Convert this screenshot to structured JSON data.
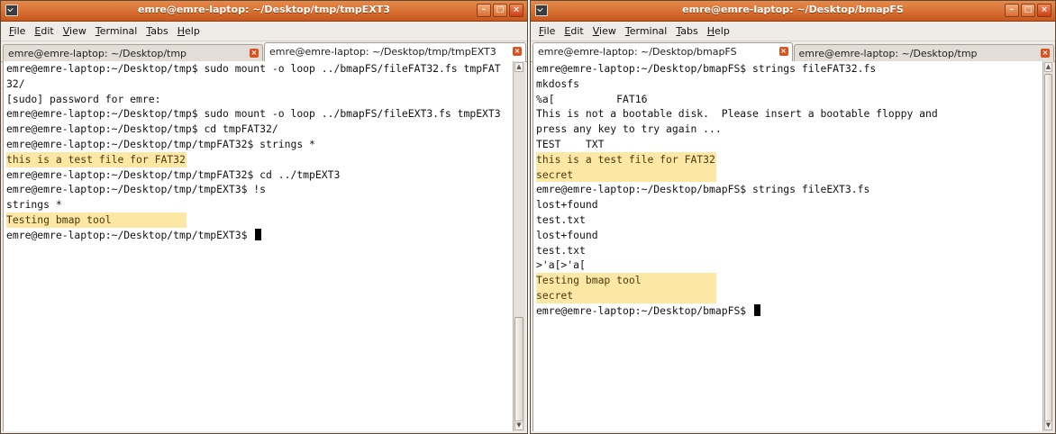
{
  "left": {
    "title": "emre@emre-laptop: ~/Desktop/tmp/tmpEXT3",
    "menus": [
      {
        "u": "F",
        "rest": "ile"
      },
      {
        "u": "E",
        "rest": "dit"
      },
      {
        "u": "V",
        "rest": "iew"
      },
      {
        "u": "T",
        "rest": "erminal"
      },
      {
        "u": "T",
        "rest": "abs"
      },
      {
        "u": "H",
        "rest": "elp"
      }
    ],
    "tabs": [
      {
        "label": "emre@emre-laptop: ~/Desktop/tmp"
      },
      {
        "label": "emre@emre-laptop: ~/Desktop/tmp/tmpEXT3"
      }
    ],
    "lines": [
      {
        "text": "emre@emre-laptop:~/Desktop/tmp$ sudo mount -o loop ../bmapFS/fileFAT32.fs tmpFAT",
        "hl": false
      },
      {
        "text": "32/",
        "hl": false
      },
      {
        "text": "[sudo] password for emre:",
        "hl": false
      },
      {
        "text": "emre@emre-laptop:~/Desktop/tmp$ sudo mount -o loop ../bmapFS/fileEXT3.fs tmpEXT3",
        "hl": false
      },
      {
        "text": "emre@emre-laptop:~/Desktop/tmp$ cd tmpFAT32/",
        "hl": false
      },
      {
        "text": "emre@emre-laptop:~/Desktop/tmp/tmpFAT32$ strings *",
        "hl": false
      },
      {
        "text": "this is a test file for FAT32",
        "hl": true
      },
      {
        "text": "emre@emre-laptop:~/Desktop/tmp/tmpFAT32$ cd ../tmpEXT3",
        "hl": false
      },
      {
        "text": "emre@emre-laptop:~/Desktop/tmp/tmpEXT3$ !s",
        "hl": false
      },
      {
        "text": "strings *",
        "hl": false
      },
      {
        "text": "Testing bmap tool",
        "hl": true
      },
      {
        "text": "emre@emre-laptop:~/Desktop/tmp/tmpEXT3$ ",
        "hl": false,
        "cursor": true
      }
    ]
  },
  "right": {
    "title": "emre@emre-laptop: ~/Desktop/bmapFS",
    "menus": [
      {
        "u": "F",
        "rest": "ile"
      },
      {
        "u": "E",
        "rest": "dit"
      },
      {
        "u": "V",
        "rest": "iew"
      },
      {
        "u": "T",
        "rest": "erminal"
      },
      {
        "u": "T",
        "rest": "abs"
      },
      {
        "u": "H",
        "rest": "elp"
      }
    ],
    "tabs": [
      {
        "label": "emre@emre-laptop: ~/Desktop/bmapFS"
      },
      {
        "label": "emre@emre-laptop: ~/Desktop/tmp"
      }
    ],
    "lines": [
      {
        "text": "emre@emre-laptop:~/Desktop/bmapFS$ strings fileFAT32.fs",
        "hl": false
      },
      {
        "text": "mkdosfs",
        "hl": false
      },
      {
        "text": "%a[          FAT16",
        "hl": false
      },
      {
        "text": "This is not a bootable disk.  Please insert a bootable floppy and",
        "hl": false
      },
      {
        "text": "press any key to try again ...",
        "hl": false
      },
      {
        "text": "TEST    TXT",
        "hl": false
      },
      {
        "text": "this is a test file for FAT32",
        "hl": true
      },
      {
        "text": "secret",
        "hl": true
      },
      {
        "text": "emre@emre-laptop:~/Desktop/bmapFS$ strings fileEXT3.fs",
        "hl": false
      },
      {
        "text": "lost+found",
        "hl": false
      },
      {
        "text": "test.txt",
        "hl": false
      },
      {
        "text": "lost+found",
        "hl": false
      },
      {
        "text": "test.txt",
        "hl": false
      },
      {
        "text": ">'a[>'a[",
        "hl": false
      },
      {
        "text": "Testing bmap tool",
        "hl": true
      },
      {
        "text": "secret",
        "hl": true
      },
      {
        "text": "emre@emre-laptop:~/Desktop/bmapFS$ ",
        "hl": false,
        "cursor": true
      }
    ]
  },
  "colors": {
    "titlebar": "#d86e33",
    "highlight": "#fde7a4",
    "tab_close": "#d9531e"
  },
  "icons": [
    "window-menu-icon",
    "minimize-icon",
    "maximize-icon",
    "close-icon",
    "tab-close-icon"
  ]
}
